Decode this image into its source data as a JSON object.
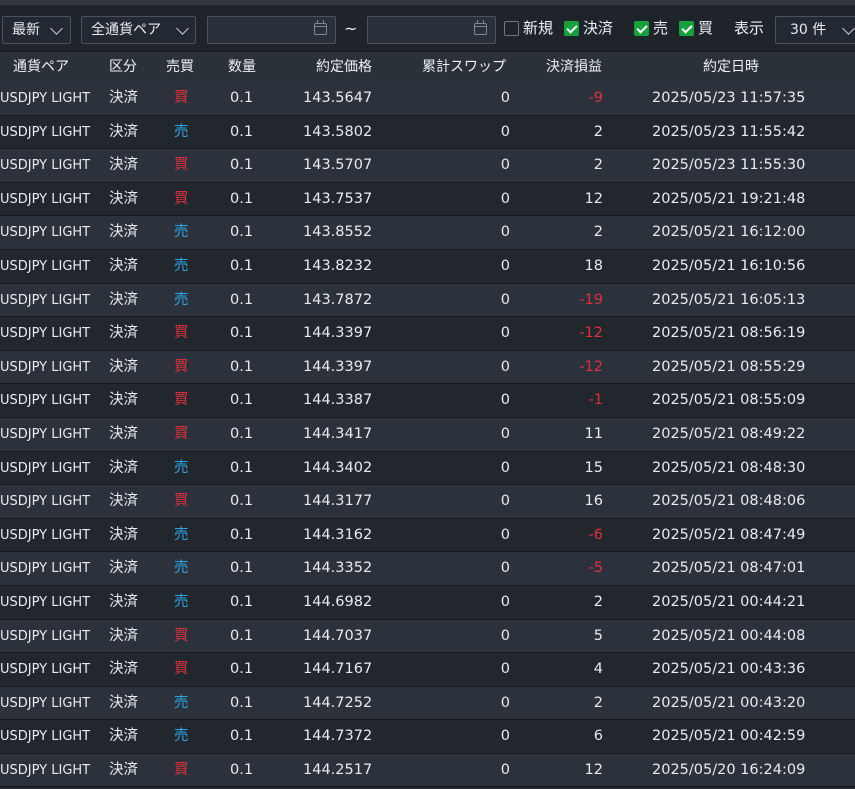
{
  "toolbar": {
    "sort_select": "最新",
    "pair_select": "全通貨ペア",
    "date_from": "",
    "date_to": "",
    "tilde": "~",
    "filters": [
      {
        "label": "新規",
        "checked": false
      },
      {
        "label": "決済",
        "checked": true
      },
      {
        "label": "売",
        "checked": true
      },
      {
        "label": "買",
        "checked": true
      }
    ],
    "display_label": "表示",
    "count_select": "30 件"
  },
  "columns": [
    "通貨ペア",
    "区分",
    "売買",
    "数量",
    "約定価格",
    "累計スワップ",
    "決済損益",
    "約定日時"
  ],
  "rows": [
    {
      "pair": "USDJPY LIGHT",
      "type": "決済",
      "side": "買",
      "qty": "0.1",
      "price": "143.5647",
      "swap": "0",
      "pnl": "-9",
      "datetime": "2025/05/23 11:57:35"
    },
    {
      "pair": "USDJPY LIGHT",
      "type": "決済",
      "side": "売",
      "qty": "0.1",
      "price": "143.5802",
      "swap": "0",
      "pnl": "2",
      "datetime": "2025/05/23 11:55:42"
    },
    {
      "pair": "USDJPY LIGHT",
      "type": "決済",
      "side": "買",
      "qty": "0.1",
      "price": "143.5707",
      "swap": "0",
      "pnl": "2",
      "datetime": "2025/05/23 11:55:30"
    },
    {
      "pair": "USDJPY LIGHT",
      "type": "決済",
      "side": "買",
      "qty": "0.1",
      "price": "143.7537",
      "swap": "0",
      "pnl": "12",
      "datetime": "2025/05/21 19:21:48"
    },
    {
      "pair": "USDJPY LIGHT",
      "type": "決済",
      "side": "売",
      "qty": "0.1",
      "price": "143.8552",
      "swap": "0",
      "pnl": "2",
      "datetime": "2025/05/21 16:12:00"
    },
    {
      "pair": "USDJPY LIGHT",
      "type": "決済",
      "side": "売",
      "qty": "0.1",
      "price": "143.8232",
      "swap": "0",
      "pnl": "18",
      "datetime": "2025/05/21 16:10:56"
    },
    {
      "pair": "USDJPY LIGHT",
      "type": "決済",
      "side": "売",
      "qty": "0.1",
      "price": "143.7872",
      "swap": "0",
      "pnl": "-19",
      "datetime": "2025/05/21 16:05:13"
    },
    {
      "pair": "USDJPY LIGHT",
      "type": "決済",
      "side": "買",
      "qty": "0.1",
      "price": "144.3397",
      "swap": "0",
      "pnl": "-12",
      "datetime": "2025/05/21 08:56:19"
    },
    {
      "pair": "USDJPY LIGHT",
      "type": "決済",
      "side": "買",
      "qty": "0.1",
      "price": "144.3397",
      "swap": "0",
      "pnl": "-12",
      "datetime": "2025/05/21 08:55:29"
    },
    {
      "pair": "USDJPY LIGHT",
      "type": "決済",
      "side": "買",
      "qty": "0.1",
      "price": "144.3387",
      "swap": "0",
      "pnl": "-1",
      "datetime": "2025/05/21 08:55:09"
    },
    {
      "pair": "USDJPY LIGHT",
      "type": "決済",
      "side": "買",
      "qty": "0.1",
      "price": "144.3417",
      "swap": "0",
      "pnl": "11",
      "datetime": "2025/05/21 08:49:22"
    },
    {
      "pair": "USDJPY LIGHT",
      "type": "決済",
      "side": "売",
      "qty": "0.1",
      "price": "144.3402",
      "swap": "0",
      "pnl": "15",
      "datetime": "2025/05/21 08:48:30"
    },
    {
      "pair": "USDJPY LIGHT",
      "type": "決済",
      "side": "買",
      "qty": "0.1",
      "price": "144.3177",
      "swap": "0",
      "pnl": "16",
      "datetime": "2025/05/21 08:48:06"
    },
    {
      "pair": "USDJPY LIGHT",
      "type": "決済",
      "side": "売",
      "qty": "0.1",
      "price": "144.3162",
      "swap": "0",
      "pnl": "-6",
      "datetime": "2025/05/21 08:47:49"
    },
    {
      "pair": "USDJPY LIGHT",
      "type": "決済",
      "side": "売",
      "qty": "0.1",
      "price": "144.3352",
      "swap": "0",
      "pnl": "-5",
      "datetime": "2025/05/21 08:47:01"
    },
    {
      "pair": "USDJPY LIGHT",
      "type": "決済",
      "side": "売",
      "qty": "0.1",
      "price": "144.6982",
      "swap": "0",
      "pnl": "2",
      "datetime": "2025/05/21 00:44:21"
    },
    {
      "pair": "USDJPY LIGHT",
      "type": "決済",
      "side": "買",
      "qty": "0.1",
      "price": "144.7037",
      "swap": "0",
      "pnl": "5",
      "datetime": "2025/05/21 00:44:08"
    },
    {
      "pair": "USDJPY LIGHT",
      "type": "決済",
      "side": "買",
      "qty": "0.1",
      "price": "144.7167",
      "swap": "0",
      "pnl": "4",
      "datetime": "2025/05/21 00:43:36"
    },
    {
      "pair": "USDJPY LIGHT",
      "type": "決済",
      "side": "売",
      "qty": "0.1",
      "price": "144.7252",
      "swap": "0",
      "pnl": "2",
      "datetime": "2025/05/21 00:43:20"
    },
    {
      "pair": "USDJPY LIGHT",
      "type": "決済",
      "side": "売",
      "qty": "0.1",
      "price": "144.7372",
      "swap": "0",
      "pnl": "6",
      "datetime": "2025/05/21 00:42:59"
    },
    {
      "pair": "USDJPY LIGHT",
      "type": "決済",
      "side": "買",
      "qty": "0.1",
      "price": "144.2517",
      "swap": "0",
      "pnl": "12",
      "datetime": "2025/05/20 16:24:09"
    }
  ],
  "colors": {
    "buy": "#e0303d",
    "sell": "#2ea3e6",
    "loss": "#e0303d",
    "check": "#18a03f"
  }
}
